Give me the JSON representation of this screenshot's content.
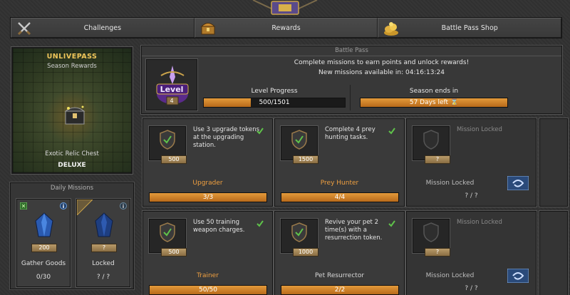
{
  "tabs": [
    {
      "label": "Challenges",
      "icon": "crossed-swords-icon"
    },
    {
      "label": "Rewards",
      "icon": "treasure-chest-icon"
    },
    {
      "label": "Battle Pass Shop",
      "icon": "gold-pile-icon"
    }
  ],
  "promo": {
    "title": "UNLIVEPASS",
    "subtitle": "Season Rewards",
    "item": "Exotic Relic Chest",
    "tier": "DELUXE"
  },
  "daily": {
    "title": "Daily Missions",
    "cards": [
      {
        "name": "Gather Goods",
        "points": "200",
        "progress": "0/30",
        "locked": false
      },
      {
        "name": "Locked",
        "points": "?",
        "progress": "? / ?",
        "locked": true
      }
    ]
  },
  "battle_pass": {
    "title": "Battle Pass",
    "level_word": "Level",
    "level": "4",
    "description": "Complete missions to earn points and unlock rewards!",
    "next_missions": "New missions available in: 04:16:13:24",
    "level_progress_label": "Level Progress",
    "level_progress_text": "500/1501",
    "level_progress_fraction": 0.333,
    "season_label": "Season ends in",
    "season_text": "57 Days left",
    "season_fraction": 1.0
  },
  "missions": [
    {
      "desc": "Use 3 upgrade tokens at the upgrading station.",
      "points": "500",
      "name": "Upgrader",
      "progress": "3/3",
      "fraction": 1.0,
      "state": "done"
    },
    {
      "desc": "Complete 4 prey hunting tasks.",
      "points": "1500",
      "name": "Prey Hunter",
      "progress": "4/4",
      "fraction": 1.0,
      "state": "done"
    },
    {
      "desc": "Mission Locked",
      "points": "?",
      "name": "Mission Locked",
      "progress": "? / ?",
      "fraction": 0,
      "state": "locked"
    },
    {
      "desc": "Use 50 training weapon charges.",
      "points": "500",
      "name": "Trainer",
      "progress": "50/50",
      "fraction": 1.0,
      "state": "done"
    },
    {
      "desc": "Revive your pet 2 time(s) with a resurrection token.",
      "points": "1000",
      "name": "Pet Resurrector",
      "progress": "2/2",
      "fraction": 1.0,
      "state": "done"
    },
    {
      "desc": "Mission Locked",
      "points": "?",
      "name": "Mission Locked",
      "progress": "? / ?",
      "fraction": 0,
      "state": "locked"
    }
  ],
  "colors": {
    "accent_orange": "#f0a040",
    "bar_fill": "#d88a2a",
    "check_green": "#5fc24a",
    "gold": "#f0c65a"
  }
}
